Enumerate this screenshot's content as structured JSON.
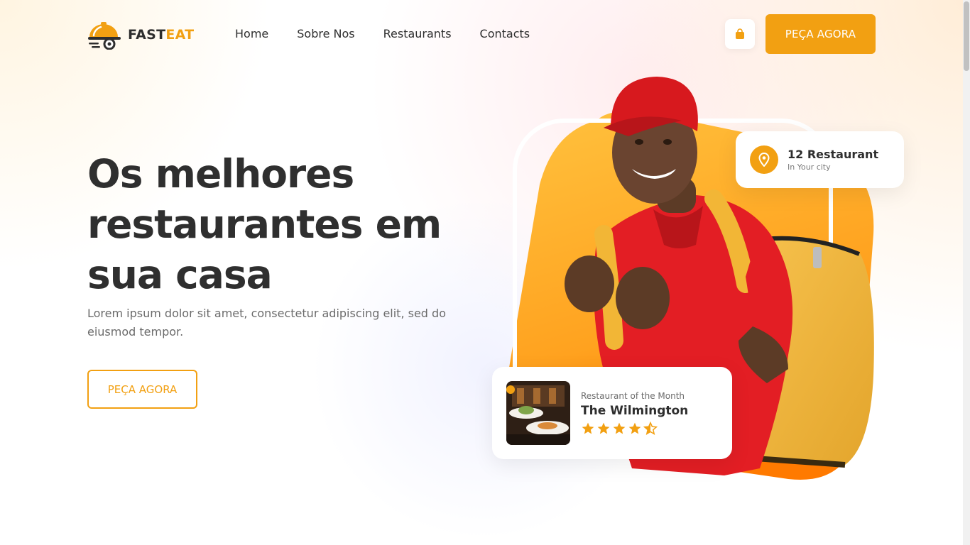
{
  "brand": {
    "name_part1": "FAST",
    "name_part2": "EAT",
    "accent": "#f2a012"
  },
  "nav": {
    "items": [
      "Home",
      "Sobre Nos",
      "Restaurants",
      "Contacts"
    ]
  },
  "header": {
    "cart_icon": "shopping-bag-icon",
    "cta_label": "PEÇA AGORA"
  },
  "hero": {
    "title": "Os melhores restaurantes em sua casa",
    "description": "Lorem ipsum dolor sit amet, consectetur adipiscing elit, sed do eiusmod tempor.",
    "cta_label": "PEÇA AGORA",
    "image_icon": "delivery-person-image"
  },
  "city_card": {
    "icon": "location-pin-icon",
    "title": "12 Restaurant",
    "subtitle": "In Your city"
  },
  "restaurant_card": {
    "label": "Restaurant of the Month",
    "name": "The Wilmington",
    "rating": 4.5,
    "rating_max": 5
  }
}
